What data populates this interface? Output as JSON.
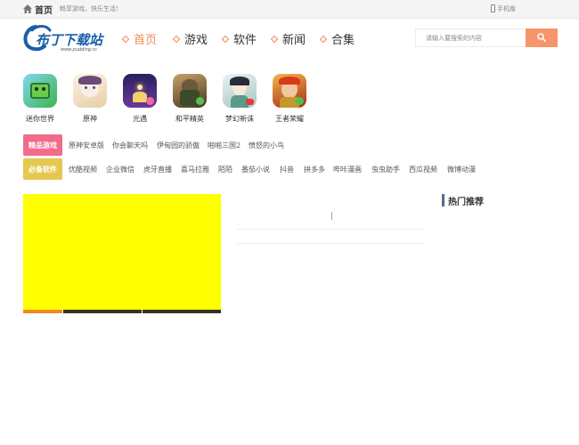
{
  "topbar": {
    "home_label": "首页",
    "slogan": "畅享游戏，快乐生活!",
    "mobile_label": "手机版"
  },
  "logo": {
    "text": "布丁下载站",
    "domain": "www.pudding.cc"
  },
  "nav": {
    "items": [
      {
        "label": "首页",
        "active": true
      },
      {
        "label": "游戏",
        "active": false
      },
      {
        "label": "软件",
        "active": false
      },
      {
        "label": "新闻",
        "active": false
      },
      {
        "label": "合集",
        "active": false
      }
    ]
  },
  "search": {
    "placeholder": "请输入要搜索的内容",
    "button_icon": "search-icon"
  },
  "apps": [
    {
      "name": "迷你世界",
      "icon_color": "#5fc25a"
    },
    {
      "name": "原神",
      "icon_color": "#f2e4d0"
    },
    {
      "name": "光遇",
      "icon_color": "#3b2a78"
    },
    {
      "name": "和平精英",
      "icon_color": "#8a6a3a"
    },
    {
      "name": "梦幻新诛",
      "icon_color": "#d8e8e0"
    },
    {
      "name": "王者荣耀",
      "icon_color": "#c2402a"
    }
  ],
  "tag_rows": [
    {
      "label": "精品游戏",
      "color": "#f26b8a",
      "links": [
        "原神安卓版",
        "你会聊天吗",
        "伊甸园的骄傲",
        "啪啪三国2",
        "愤怒的小鸟"
      ]
    },
    {
      "label": "必备软件",
      "color": "#e5c84f",
      "links": [
        "优酷视频",
        "企业微信",
        "虎牙直播",
        "喜马拉雅",
        "陌陌",
        "番茄小说",
        "抖音",
        "拼多多",
        "哔咔漫画",
        "虫虫助手",
        "西瓜视频",
        "微博动漫"
      ]
    }
  ],
  "banner": {
    "color": "#ffff00",
    "slide_count": 5,
    "active_index": 0
  },
  "middle": {
    "text": "|"
  },
  "hot": {
    "title": "热门推荐"
  }
}
